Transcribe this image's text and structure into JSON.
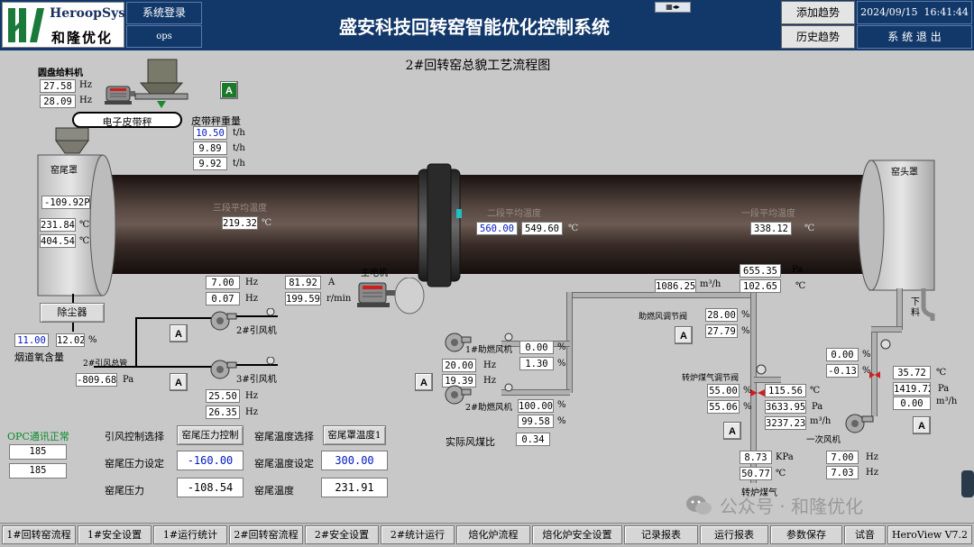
{
  "header": {
    "logo_text": "HeroopSys",
    "logo_sub": "和隆优化",
    "login_label": "系统登录",
    "user": "ops",
    "title": "盛安科技回转窑智能优化控制系统",
    "add_trend": "添加趋势",
    "history_trend": "历史趋势",
    "date": "2024/09/15",
    "time": "16:41:44",
    "exit": "系 统 退 出"
  },
  "page_title": "2#回转窑总貌工艺流程图",
  "feeder": {
    "title": "圆盘给料机",
    "hz1": "27.58",
    "hz2": "28.09",
    "unit_hz": "Hz",
    "a_label": "A",
    "belt_label": "电子皮带秤",
    "weight_title": "皮带秤重量",
    "w1": "10.50",
    "w2": "9.89",
    "w3": "9.92",
    "unit_th": "t/h"
  },
  "kiln": {
    "tail_label": "窑尾罩",
    "head_label": "窑头罩",
    "tail_pressure": "-109.92",
    "unit_pa": "Pa",
    "tail_t1": "231.84",
    "tail_t2": "404.54",
    "unit_c": "℃",
    "zone3_label": "三段平均温度",
    "zone3_val": "219.32",
    "zone2_label": "二段平均温度",
    "zone2_set": "560.00",
    "zone2_val": "549.60",
    "zone1_label": "一段平均温度",
    "zone1_val": "338.12",
    "main_motor": "主电机",
    "motor_hz": "7.00",
    "motor_hz2": "0.07",
    "motor_a": "81.92",
    "unit_a": "A",
    "motor_rpm": "199.59",
    "unit_rpm": "r/min",
    "discharge": "下料"
  },
  "dust": {
    "label": "除尘器",
    "o2_set": "11.00",
    "o2_val": "12.02",
    "unit_pct": "%",
    "o2_label": "烟道氧含量",
    "main_pipe_label": "2#引风总管",
    "main_pipe_val": "-809.68",
    "fan2_label": "2#引风机",
    "fan3_label": "3#引风机",
    "fan3_hz1": "25.50",
    "fan3_hz2": "26.35"
  },
  "combustion": {
    "fan1_label": "1#助燃风机",
    "fan1_pct1": "0.00",
    "fan1_pct2": "1.30",
    "fan1_hz1": "20.00",
    "fan1_hz2": "19.39",
    "fan2_label": "2#助燃风机",
    "fan2_pct1": "100.00",
    "fan2_pct2": "99.58",
    "ratio_label": "实际风煤比",
    "ratio_val": "0.34",
    "flow_top": "1086.25",
    "unit_m3h": "m³/h",
    "p_top": "655.35",
    "t_top": "102.65",
    "valve_label": "助燃风调节阀",
    "valve_v1": "28.00",
    "valve_v2": "27.79",
    "gas_valve_label": "转炉煤气调节阀",
    "gas_v1": "55.00",
    "gas_v2": "55.06",
    "gas_t": "115.56",
    "gas_p": "3633.95",
    "gas_flow": "3237.23",
    "gas_kpa": "8.73",
    "unit_kpa": "KPa",
    "gas_t2": "50.77",
    "gas_label": "转炉煤气",
    "prim_v1": "0.00",
    "prim_v2": "-0.13",
    "prim_t": "35.72",
    "prim_p": "1419.72",
    "prim_flow": "0.00",
    "prim_label": "一次风机",
    "prim_hz1": "7.00",
    "prim_hz2": "7.03"
  },
  "control": {
    "opc_status": "OPC通讯正常",
    "opc_v1": "185",
    "opc_v2": "185",
    "fan_ctrl_label": "引风控制选择",
    "fan_ctrl_btn": "窑尾压力控制",
    "temp_sel_label": "窑尾温度选择",
    "temp_sel_btn": "窑尾罩温度1",
    "p_set_label": "窑尾压力设定",
    "p_set": "-160.00",
    "t_set_label": "窑尾温度设定",
    "t_set": "300.00",
    "p_label": "窑尾压力",
    "p_val": "-108.54",
    "t_label": "窑尾温度",
    "t_val": "231.91"
  },
  "bottom_nav": [
    "1#回转窑流程",
    "1#安全设置",
    "1#运行统计",
    "2#回转窑流程",
    "2#安全设置",
    "2#统计运行",
    "焙化炉流程",
    "焙化炉安全设置",
    "记录报表",
    "运行报表",
    "参数保存",
    "试音",
    "HeroView V7.2"
  ],
  "watermark": "公众号 · 和隆优化",
  "colors": {
    "header_bg": "#12386a",
    "kiln": "#3a2a26",
    "bg": "#c8c8c8",
    "set_blue": "#0018c0",
    "opc_green": "#0a8a2a"
  }
}
